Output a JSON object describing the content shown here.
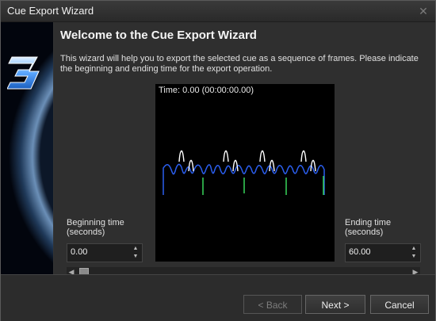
{
  "window": {
    "title": "Cue Export Wizard"
  },
  "wizard": {
    "heading": "Welcome to the Cue Export Wizard",
    "description": "This wizard will help you to export the selected cue as a sequence of frames. Please indicate the beginning and ending time for the export operation."
  },
  "preview": {
    "time_label": "Time: 0.00 (00:00:00.00)"
  },
  "beginning": {
    "label_line1": "Beginning time",
    "label_line2": "(seconds)",
    "value": "0.00"
  },
  "ending": {
    "label_line1": "Ending time",
    "label_line2": "(seconds)",
    "value": "60.00"
  },
  "buttons": {
    "back": "< Back",
    "next": "Next >",
    "cancel": "Cancel"
  },
  "icons": {
    "close": "close-icon",
    "logo": "logo-3-icon"
  },
  "slider": {
    "position_fraction": 0.0
  },
  "colors": {
    "wave_blue": "#2b5ff0",
    "wave_white": "#ffffff",
    "wave_green": "#39d65b"
  }
}
